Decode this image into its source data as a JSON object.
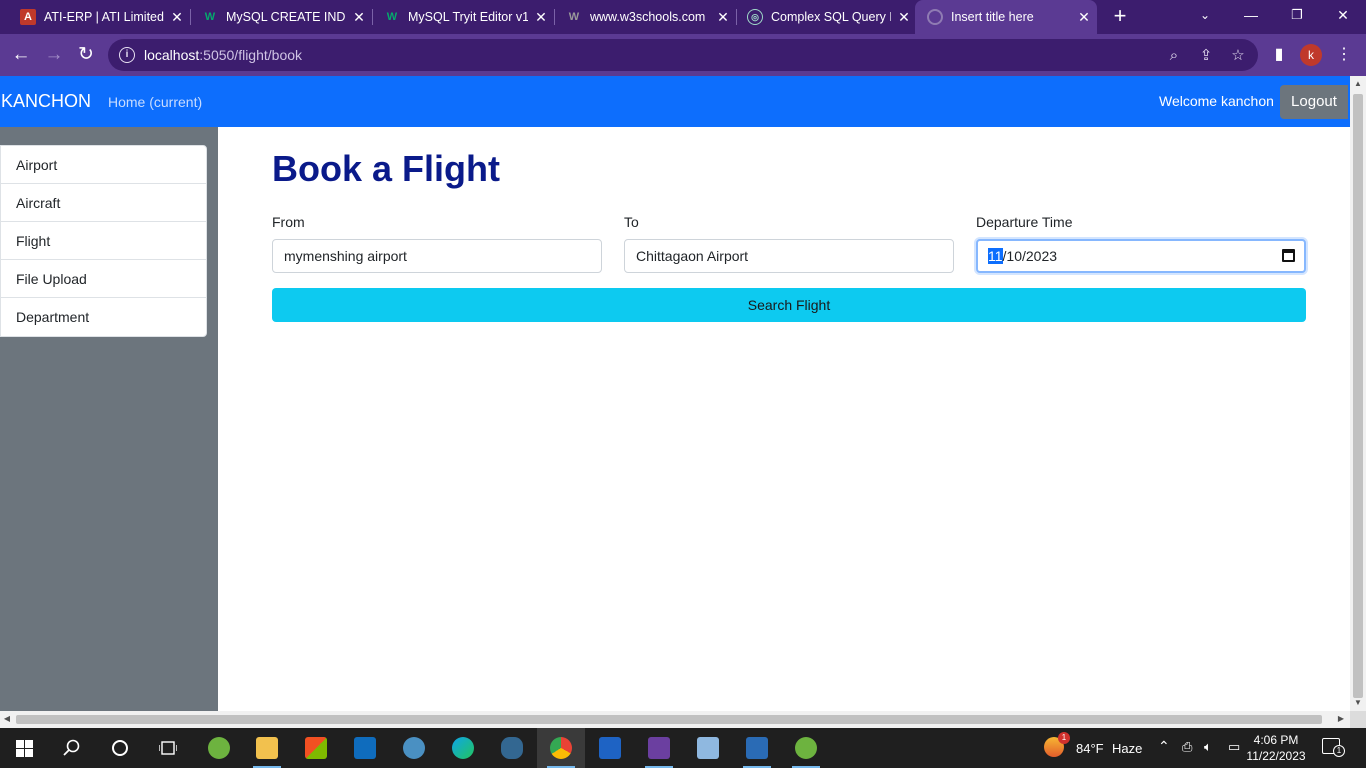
{
  "browser": {
    "tabs": [
      {
        "title": "ATI-ERP | ATI Limited",
        "icon": "ati-logo-icon",
        "close": "✕"
      },
      {
        "title": "MySQL CREATE INDEX",
        "icon": "w3schools-icon",
        "close": "✕"
      },
      {
        "title": "MySQL Tryit Editor v1",
        "icon": "w3schools-icon",
        "close": "✕"
      },
      {
        "title": "www.w3schools.com",
        "icon": "w3schools-icon",
        "close": "✕"
      },
      {
        "title": "Complex SQL Query E",
        "icon": "chatgpt-icon",
        "close": "✕"
      },
      {
        "title": "Insert title here",
        "icon": "globe-icon",
        "close": "✕"
      }
    ],
    "new_tab": "+",
    "url_host": "localhost",
    "url_rest": ":5050/flight/book",
    "profile_initial": "k"
  },
  "navbar": {
    "brand": "KANCHON",
    "home_link": "Home (current)",
    "welcome": "Welcome kanchon",
    "logout": "Logout"
  },
  "sidebar": {
    "items": [
      {
        "label": "Airport"
      },
      {
        "label": "Aircraft"
      },
      {
        "label": "Flight"
      },
      {
        "label": "File Upload"
      },
      {
        "label": "Department"
      }
    ]
  },
  "form": {
    "title": "Book a Flight",
    "from_label": "From",
    "from_value": "mymenshing airport",
    "to_label": "To",
    "to_value": "Chittagaon Airport",
    "departure_label": "Departure Time",
    "departure_month": "11",
    "departure_rest": "/10/2023",
    "search_button": "Search Flight"
  },
  "taskbar": {
    "weather_temp": "84°F",
    "weather_desc": "Haze",
    "weather_badge": "1",
    "time": "4:06 PM",
    "date": "11/22/2023",
    "notification_count": "1"
  },
  "colors": {
    "navbar": "#0d6efd",
    "sidebar": "#6c757d",
    "search_button": "#0dcaf0",
    "title": "#0a1a8a",
    "browser_frame": "#5b3a93"
  }
}
